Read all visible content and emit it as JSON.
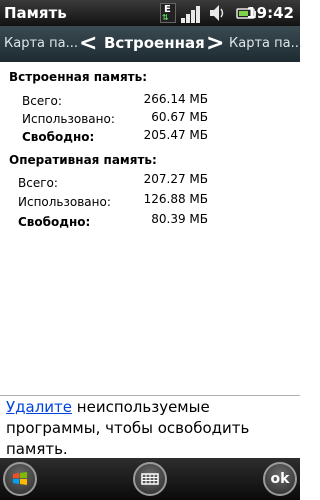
{
  "status_bar": {
    "title": "Память",
    "time": "19:42",
    "network_type": "E",
    "icons": [
      "edge-data-icon",
      "signal-strength-icon",
      "volume-icon",
      "battery-icon"
    ]
  },
  "pivot": {
    "left_tab": "Карта па...",
    "current_tab": "Встроенная",
    "right_tab": "Карта па..."
  },
  "builtin_memory": {
    "title": "Встроенная память:",
    "rows": [
      {
        "label": "Всего:",
        "value": "266.14 МБ"
      },
      {
        "label": "Использовано:",
        "value": "60.67 МБ"
      },
      {
        "label": "Свободно:",
        "value": "205.47 МБ"
      }
    ]
  },
  "ram": {
    "title": "Оперативная память:",
    "rows": [
      {
        "label": "Всего:",
        "value": "207.27 МБ"
      },
      {
        "label": "Использовано:",
        "value": "126.88 МБ"
      },
      {
        "label": "Свободно:",
        "value": "80.39 МБ"
      }
    ]
  },
  "message": {
    "link": "Удалите",
    "line1_rest": " неиспользуемые",
    "line2": "программы, чтобы освободить",
    "line3": "память."
  },
  "softkeys": {
    "ok_label": "ok",
    "icons": [
      "windows-start-icon",
      "keyboard-icon"
    ]
  }
}
